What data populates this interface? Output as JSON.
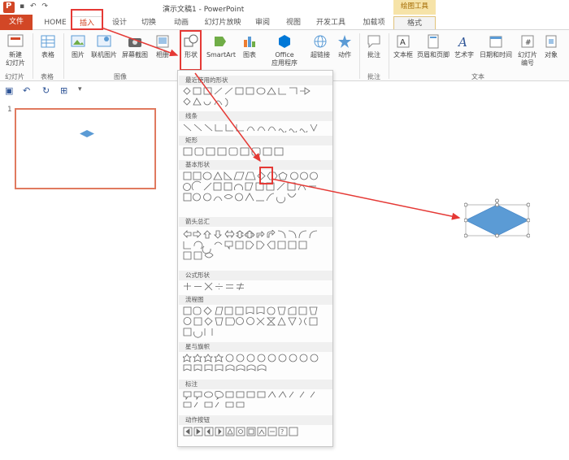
{
  "titlebar": {
    "window_title": "演示文稿1 - PowerPoint",
    "context_group": "绘图工具"
  },
  "tabs": [
    {
      "id": "file",
      "label": "文件"
    },
    {
      "id": "home",
      "label": "HOME"
    },
    {
      "id": "insert",
      "label": "插入"
    },
    {
      "id": "design",
      "label": "设计"
    },
    {
      "id": "transitions",
      "label": "切换"
    },
    {
      "id": "animations",
      "label": "动画"
    },
    {
      "id": "slideshow",
      "label": "幻灯片放映"
    },
    {
      "id": "review",
      "label": "审阅"
    },
    {
      "id": "view",
      "label": "视图"
    },
    {
      "id": "developer",
      "label": "开发工具"
    },
    {
      "id": "addins",
      "label": "加载项"
    },
    {
      "id": "format",
      "label": "格式"
    }
  ],
  "ribbon": {
    "new_slide": "新建\n幻灯片",
    "table": "表格",
    "picture": "图片",
    "online_picture": "联机图片",
    "screenshot": "屏幕截图",
    "photo_album": "相册",
    "shapes": "形状",
    "smartart": "SmartArt",
    "chart": "图表",
    "office_apps": "Office\n应用程序",
    "hyperlink": "超链接",
    "action": "动作",
    "comment": "批注",
    "textbox": "文本框",
    "header_footer": "页眉和页脚",
    "wordart": "艺术字",
    "datetime": "日期和时间",
    "slide_number": "幻灯片\n编号",
    "object": "对象",
    "groups": {
      "slides": "幻灯片",
      "tables": "表格",
      "images": "图像",
      "comments": "批注",
      "text": "文本"
    }
  },
  "slide_panel": {
    "slide_number": "1"
  },
  "gallery": {
    "categories": [
      "最近使用的形状",
      "线条",
      "矩形",
      "基本形状",
      "箭头总汇",
      "公式形状",
      "流程图",
      "星与旗帜",
      "标注",
      "动作按钮"
    ]
  },
  "colors": {
    "accent": "#d24726",
    "shape_fill": "#5b9bd5",
    "annotation": "#e53935"
  }
}
